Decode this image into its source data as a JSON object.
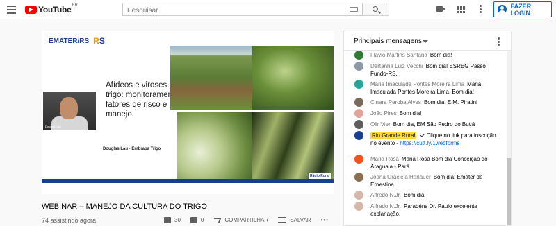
{
  "header": {
    "logo_text": "YouTube",
    "logo_region": "BR",
    "search_placeholder": "Pesquisar",
    "login_label": "FAZER LOGIN"
  },
  "video": {
    "slide": {
      "logo_left": "EMATER/RS",
      "logo_right_a": "R",
      "logo_right_b": "S",
      "title": "Afídeos e viroses em trigo: monitoramento, fatores de risco e manejo.",
      "author": "Douglas Lau - Embrapa Trigo",
      "cam_label": "Douglas Lau",
      "bottom_logo": "Rádio Rural"
    },
    "title": "WEBINAR – MANEJO DA CULTURA DO TRIGO",
    "viewers": "74 assistindo agora",
    "likes": "30",
    "dislikes": "0",
    "share_label": "COMPARTILHAR",
    "save_label": "SALVAR",
    "more_label": "•••"
  },
  "chat": {
    "header_label": "Principais mensagens",
    "messages": [
      {
        "author": "Flavio Martins Santana",
        "text": "Bom dia!",
        "avatar_color": "#2e7d32"
      },
      {
        "author": "Dartanhã Luiz Vecchi",
        "text": "Bom dia! ESREG Passo Fundo-RS.",
        "avatar_color": "#8d9aa6"
      },
      {
        "author": "Maria Imaculada Pontes Moreira Lima",
        "text": "Maria Imaculada Pontes Moreira Lima. Bom dia!",
        "avatar_color": "#26a69a"
      },
      {
        "author": "Cinara Peroba Alves",
        "text": "Bom dia! E.M. Piratini",
        "avatar_color": "#7a6a5c"
      },
      {
        "author": "João Pires",
        "text": "Bom dia!",
        "avatar_color": "#e1a39a"
      },
      {
        "author": "Olir Vier",
        "text": "Bom dia, EM São Pedro do Butiá",
        "avatar_color": "#5d5d5d"
      },
      {
        "author": "Rio Grande Rural",
        "text": "Clique no link para inscrição no evento - ",
        "link": "https://cutt.ly/1webforms",
        "avatar_color": "#1a3e8e",
        "badge": true
      },
      {
        "author": "Maria Rosa",
        "text": "Maria Rosa Bom dia Conceição do Araguaia - Pará",
        "avatar_color": "#f4511e"
      },
      {
        "author": "Joana Graciela Hanauer",
        "text": "Bom dia! Emater de Ernestina.",
        "avatar_color": "#8e6e53"
      },
      {
        "author": "Alfredo N.Jr.",
        "text": "Bom dia,",
        "avatar_color": "#d7b8a8"
      },
      {
        "author": "Alfredo N.Jr.",
        "text": "Parabéns Dr. Paulo excelente explanação.",
        "avatar_color": "#d7b8a8"
      }
    ]
  }
}
